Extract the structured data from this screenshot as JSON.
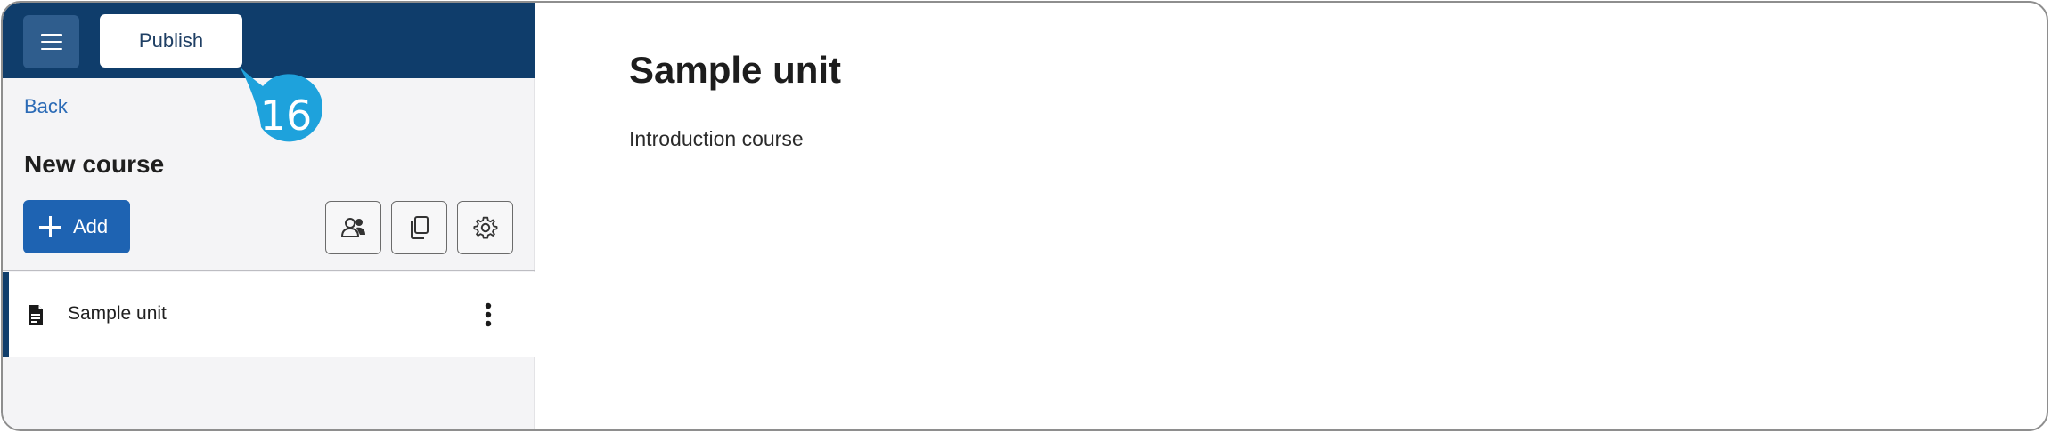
{
  "toolbar": {
    "menu_icon": "hamburger-menu-icon",
    "publish_label": "Publish"
  },
  "callout": {
    "step_number": "16",
    "color": "#1ea2dc"
  },
  "sidebar": {
    "back_label": "Back",
    "course_title": "New course",
    "add_label": "Add",
    "tools": [
      {
        "icon": "users-icon"
      },
      {
        "icon": "copy-icon"
      },
      {
        "icon": "gear-icon"
      }
    ],
    "items": [
      {
        "label": "Sample unit",
        "icon": "document-icon",
        "menu_icon": "kebab-menu-icon"
      }
    ]
  },
  "main": {
    "title": "Sample unit",
    "description": "Introduction course"
  },
  "colors": {
    "header_bg": "#0f3d6b",
    "accent": "#1e63b2",
    "link": "#2a6ab6"
  }
}
